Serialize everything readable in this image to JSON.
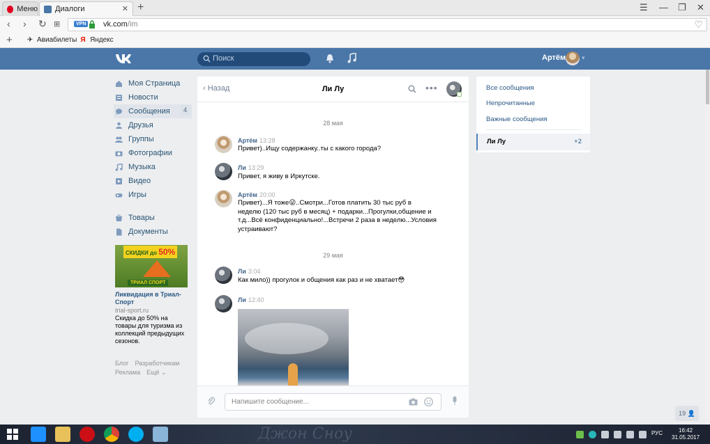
{
  "browser": {
    "tabs": [
      {
        "label": "Меню",
        "icon": "opera-icon"
      },
      {
        "label": "Диалоги",
        "icon": "vk-icon"
      }
    ],
    "url": {
      "host": "vk.com",
      "path": "/im",
      "vpn_badge": "VPN"
    },
    "bookmarks": [
      {
        "label": "Авиабилеты",
        "icon": "plane-icon"
      },
      {
        "label": "Яндекс",
        "icon": "yandex-icon"
      }
    ]
  },
  "vk_header": {
    "search_placeholder": "Поиск",
    "user_name": "Артём"
  },
  "left_menu": {
    "items": [
      {
        "label": "Моя Страница",
        "icon": "home-icon"
      },
      {
        "label": "Новости",
        "icon": "news-icon"
      },
      {
        "label": "Сообщения",
        "icon": "messages-icon",
        "count": "4"
      },
      {
        "label": "Друзья",
        "icon": "friends-icon"
      },
      {
        "label": "Группы",
        "icon": "groups-icon"
      },
      {
        "label": "Фотографии",
        "icon": "camera-icon"
      },
      {
        "label": "Музыка",
        "icon": "music-icon"
      },
      {
        "label": "Видео",
        "icon": "video-icon"
      },
      {
        "label": "Игры",
        "icon": "gamepad-icon"
      }
    ],
    "items2": [
      {
        "label": "Товары",
        "icon": "shop-icon"
      },
      {
        "label": "Документы",
        "icon": "document-icon"
      }
    ]
  },
  "ad": {
    "banner_top": "СКИДКИ",
    "banner_pre": "до",
    "banner_pct": "50%",
    "brand": "ТРИАЛ СПОРТ",
    "title": "Ликвидация в Триал-Спорт",
    "domain": "trial-sport.ru",
    "desc": "Скидка до 50% на товары для туризма из коллекций предыдущих сезонов."
  },
  "footer": {
    "links": [
      "Блог",
      "Разработчикам",
      "Реклама",
      "Ещё ⌄"
    ]
  },
  "chat": {
    "back_label": "Назад",
    "title": "Ли Лу",
    "dates": [
      "28 мая",
      "29 мая"
    ],
    "messages": [
      {
        "author": "Артём",
        "time": "13:28",
        "text": "Привет)..Ищу содержанку..ты с какого города?"
      },
      {
        "author": "Ли",
        "time": "13:29",
        "text": "Привет, я живу в Иркутске."
      },
      {
        "author": "Артём",
        "time": "20:00",
        "text": "Привет)...Я тоже😜..Смотри...Готов платить 30 тыс руб в неделю (120 тыс руб в месяц) + подарки...Прогулки,общение и т.д...Всё конфиденциально!...Встречи 2 раза в неделю...Условия устраивают?"
      },
      {
        "author": "Ли",
        "time": "3:04",
        "text": "Как мило)) прогулок и общения как раз и не хватает😳"
      },
      {
        "author": "Ли",
        "time": "12:40",
        "text": ""
      }
    ],
    "composer_placeholder": "Напишите сообщение..."
  },
  "right_panel": {
    "links": [
      "Все сообщения",
      "Непрочитанные",
      "Важные сообщения"
    ],
    "active_dialog": {
      "name": "Ли Лу",
      "count": "+2"
    }
  },
  "online_badge": "19",
  "taskbar": {
    "watermark": "Джон Сноу",
    "lang": "РУС",
    "time": "16:42",
    "date": "31.05.2017"
  },
  "colors": {
    "vk_blue": "#4a76a8",
    "link": "#2a5885",
    "bg": "#edeef0"
  }
}
